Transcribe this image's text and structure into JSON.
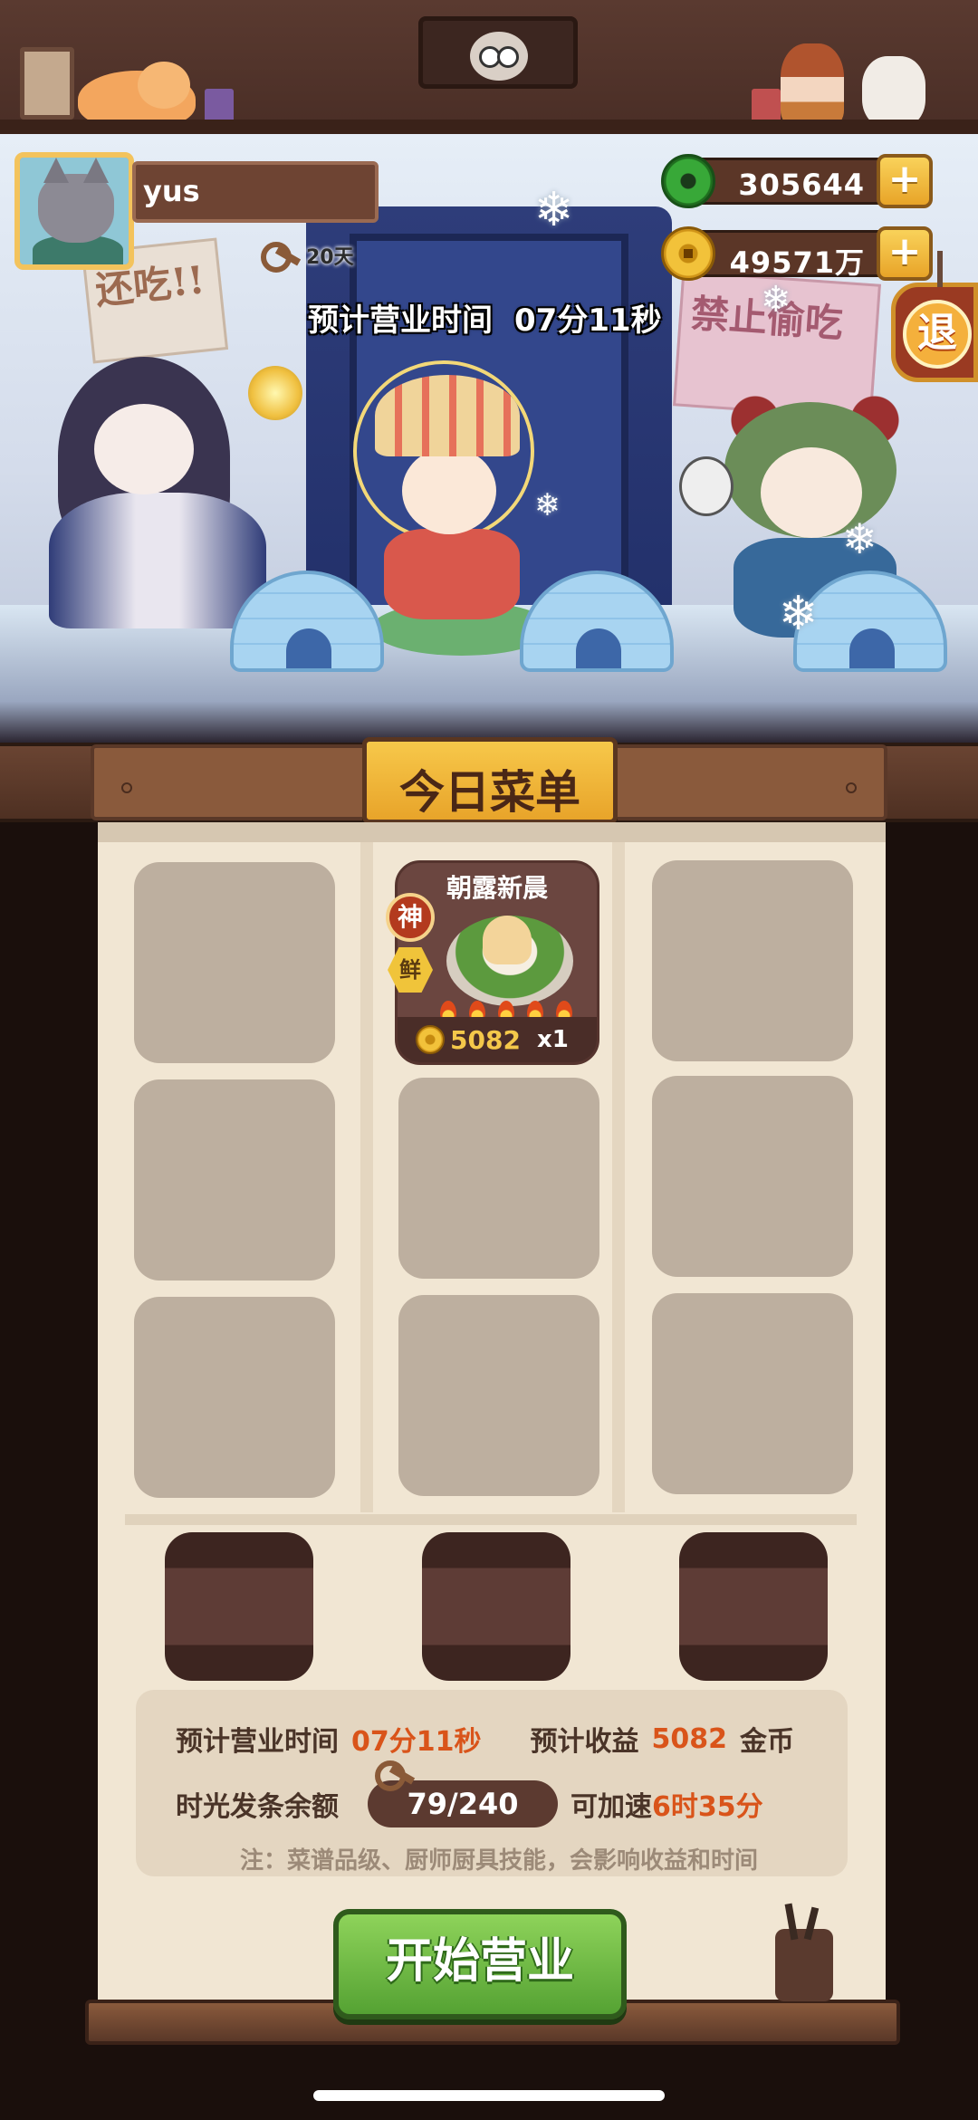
{
  "player": {
    "name": "yus",
    "days": "20天"
  },
  "currency": {
    "jade": "305644",
    "coins": "49571万"
  },
  "buttons": {
    "add": "+",
    "exit": "退",
    "start": "开始营业"
  },
  "scene": {
    "time_label": "预计营业时间",
    "time_value": "07分11秒",
    "sign_left": "还吃!!",
    "sign_right": "禁止偷吃"
  },
  "menu": {
    "title": "今日菜单",
    "dish": {
      "name": "朝露新晨",
      "badge_grade": "神",
      "badge_type": "鲜",
      "price": "5082",
      "qty": "x1"
    }
  },
  "summary": {
    "time_label": "预计营业时间",
    "time_value": "07分11秒",
    "income_label": "预计收益",
    "income_value": "5082",
    "income_unit": "金币",
    "balance_label": "时光发条余额",
    "balance_value": "79/240",
    "speedup_label": "可加速",
    "speedup_value": "6时35分",
    "note": "注：菜谱品级、厨师厨具技能，会影响收益和时间"
  },
  "colors": {
    "accent_orange": "#d9541a",
    "start_green": "#55a233",
    "gold": "#f2c23a"
  }
}
